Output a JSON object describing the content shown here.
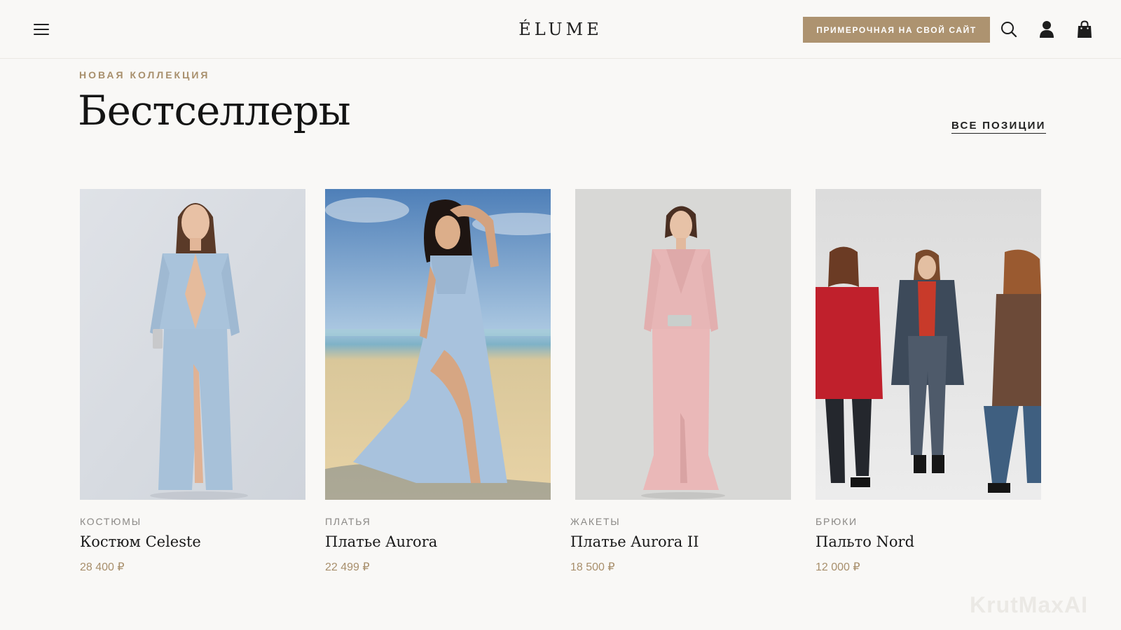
{
  "header": {
    "logo": "ÉLUME",
    "cta_label": "ПРИМЕРОЧНАЯ НА СВОЙ САЙТ",
    "icons": [
      "menu-icon",
      "search-icon",
      "user-icon",
      "shopping-bag-icon"
    ]
  },
  "section": {
    "eyebrow": "НОВАЯ КОЛЛЕКЦИЯ",
    "title": "Бестселлеры",
    "all_link": "ВСЕ ПОЗИЦИИ"
  },
  "products": [
    {
      "category": "КОСТЮМЫ",
      "name": "Костюм Celeste",
      "price": "28 400 ₽"
    },
    {
      "category": "ПЛАТЬЯ",
      "name": "Платье Aurora",
      "price": "22 499 ₽"
    },
    {
      "category": "ЖАКЕТЫ",
      "name": "Платье Aurora II",
      "price": "18 500 ₽"
    },
    {
      "category": "БРЮКИ",
      "name": "Пальто Nord",
      "price": "12 000 ₽"
    }
  ],
  "watermark": "KrutMaxAI",
  "colors": {
    "accent": "#ad9370",
    "price": "#a88f6c",
    "background": "#f9f8f6",
    "text": "#1a1a1a"
  }
}
